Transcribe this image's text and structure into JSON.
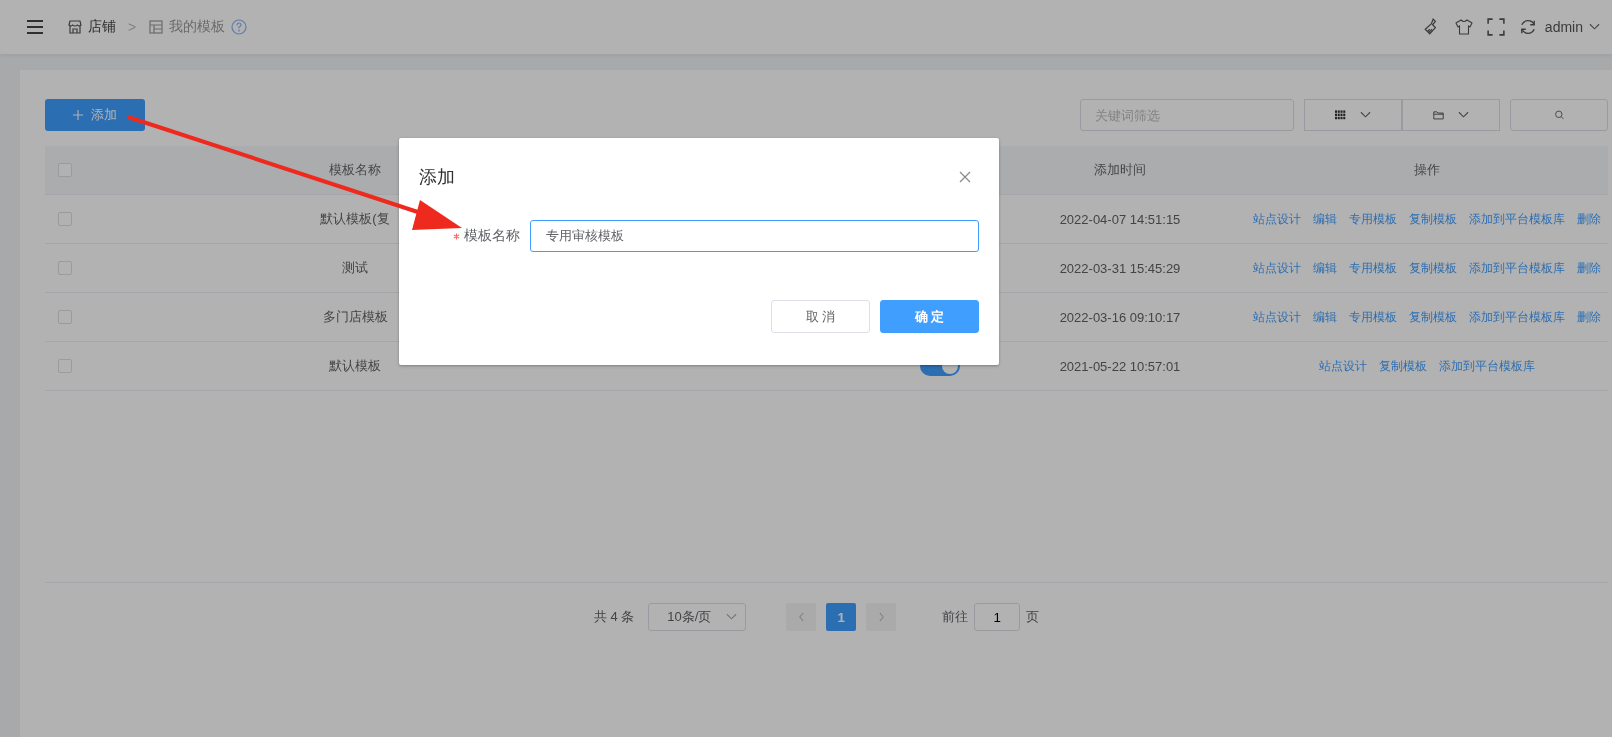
{
  "header": {
    "breadcrumbs": [
      {
        "label": "店铺"
      },
      {
        "label": "我的模板"
      }
    ],
    "separator": ">",
    "user": "admin"
  },
  "toolbar": {
    "add_button": "添加",
    "search": {
      "placeholder": "关键词筛选"
    }
  },
  "table": {
    "columns": [
      "模板名称",
      "添加时间",
      "操作"
    ],
    "header_checked": false,
    "rows": [
      {
        "name": "默认模板(复",
        "checked": false,
        "added": "2022-04-07 14:51:15",
        "actions": [
          "站点设计",
          "编辑",
          "专用模板",
          "复制模板",
          "添加到平台模板库",
          "删除"
        ]
      },
      {
        "name": "测试",
        "checked": false,
        "added": "2022-03-31 15:45:29",
        "actions": [
          "站点设计",
          "编辑",
          "专用模板",
          "复制模板",
          "添加到平台模板库",
          "删除"
        ]
      },
      {
        "name": "多门店模板",
        "checked": false,
        "added": "2022-03-16 09:10:17",
        "actions": [
          "站点设计",
          "编辑",
          "专用模板",
          "复制模板",
          "添加到平台模板库",
          "删除"
        ]
      },
      {
        "name": "默认模板",
        "checked": false,
        "added": "2021-05-22 10:57:01",
        "switch_on": true,
        "actions": [
          "站点设计",
          "复制模板",
          "添加到平台模板库"
        ]
      }
    ]
  },
  "pagination": {
    "total": "共 4 条",
    "page_size": "10条/页",
    "pages": [
      {
        "label": "1",
        "selected": true
      }
    ],
    "goto_label": "前往",
    "goto_value": "1",
    "goto_suffix": "页"
  },
  "dialog": {
    "title": "添加",
    "field_label": "模板名称",
    "required": true,
    "value": "专用审核模板",
    "buttons": [
      {
        "label": "取 消",
        "kind": "default"
      },
      {
        "label": "确 定",
        "kind": "primary"
      }
    ]
  }
}
